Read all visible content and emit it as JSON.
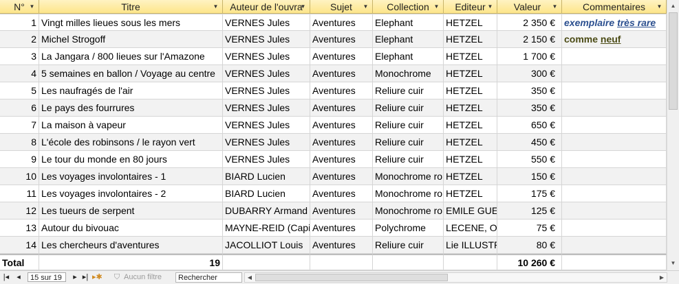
{
  "columns": {
    "no": "N°",
    "titre": "Titre",
    "auteur": "Auteur de l'ouvra",
    "sujet": "Sujet",
    "collection": "Collection",
    "editeur": "Editeur",
    "valeur": "Valeur",
    "commentaires": "Commentaires"
  },
  "rows": [
    {
      "no": "1",
      "titre": "Vingt milles lieues sous les mers",
      "auteur": "VERNES Jules",
      "sujet": "Aventures",
      "collection": "Elephant",
      "editeur": "HETZEL",
      "valeur": "2 350 €"
    },
    {
      "no": "2",
      "titre": "Michel Strogoff",
      "auteur": "VERNES Jules",
      "sujet": "Aventures",
      "collection": "Elephant",
      "editeur": "HETZEL",
      "valeur": "2 150 €"
    },
    {
      "no": "3",
      "titre": "La Jangara / 800 lieues sur l'Amazone",
      "auteur": "VERNES Jules",
      "sujet": "Aventures",
      "collection": "Elephant",
      "editeur": "HETZEL",
      "valeur": "1 700 €"
    },
    {
      "no": "4",
      "titre": "5 semaines en ballon / Voyage au centre",
      "auteur": "VERNES Jules",
      "sujet": "Aventures",
      "collection": "Monochrome",
      "editeur": "HETZEL",
      "valeur": "300 €"
    },
    {
      "no": "5",
      "titre": "Les naufragés de l'air",
      "auteur": "VERNES Jules",
      "sujet": "Aventures",
      "collection": "Reliure cuir",
      "editeur": "HETZEL",
      "valeur": "350 €"
    },
    {
      "no": "6",
      "titre": "Le pays des fourrures",
      "auteur": "VERNES Jules",
      "sujet": "Aventures",
      "collection": "Reliure cuir",
      "editeur": "HETZEL",
      "valeur": "350 €"
    },
    {
      "no": "7",
      "titre": "La maison à vapeur",
      "auteur": "VERNES Jules",
      "sujet": "Aventures",
      "collection": "Reliure cuir",
      "editeur": "HETZEL",
      "valeur": "650 €"
    },
    {
      "no": "8",
      "titre": "L'école des robinsons / le rayon vert",
      "auteur": "VERNES Jules",
      "sujet": "Aventures",
      "collection": "Reliure cuir",
      "editeur": "HETZEL",
      "valeur": "450 €"
    },
    {
      "no": "9",
      "titre": "Le tour du monde en 80 jours",
      "auteur": "VERNES Jules",
      "sujet": "Aventures",
      "collection": "Reliure cuir",
      "editeur": "HETZEL",
      "valeur": "550 €"
    },
    {
      "no": "10",
      "titre": "Les voyages involontaires - 1",
      "auteur": "BIARD Lucien",
      "sujet": "Aventures",
      "collection": "Monochrome ro",
      "editeur": "HETZEL",
      "valeur": "150 €"
    },
    {
      "no": "11",
      "titre": "Les voyages involontaires - 2",
      "auteur": "BIARD Lucien",
      "sujet": "Aventures",
      "collection": "Monochrome ro",
      "editeur": "HETZEL",
      "valeur": "175 €"
    },
    {
      "no": "12",
      "titre": "Les tueurs de serpent",
      "auteur": "DUBARRY Armand",
      "sujet": "Aventures",
      "collection": "Monochrome ro",
      "editeur": "EMILE GUE",
      "valeur": "125 €"
    },
    {
      "no": "13",
      "titre": "Autour du bivouac",
      "auteur": "MAYNE-REID (Capi",
      "sujet": "Aventures",
      "collection": "Polychrome",
      "editeur": "LECENE, OU",
      "valeur": "75 €"
    },
    {
      "no": "14",
      "titre": "Les chercheurs d'aventures",
      "auteur": "JACOLLIOT Louis",
      "sujet": "Aventures",
      "collection": "Reliure cuir",
      "editeur": "Lie ILLUSTR",
      "valeur": "80 €"
    }
  ],
  "comments": {
    "row1": {
      "pre": "exemplaire ",
      "underlined": "très rare"
    },
    "row2": {
      "pre": "comme ",
      "underlined": "neuf"
    }
  },
  "total": {
    "label": "Total",
    "count": "19",
    "valeur": "10 260 €"
  },
  "navbar": {
    "record_position": "15 sur 19",
    "filter_label": "Aucun filtre",
    "search_label": "Rechercher"
  },
  "colors": {
    "header_bg": "#fde58a",
    "alt_row": "#f2f2f2",
    "comment_rare": "#2b4f8f",
    "comment_neuf": "#4a4a14"
  }
}
